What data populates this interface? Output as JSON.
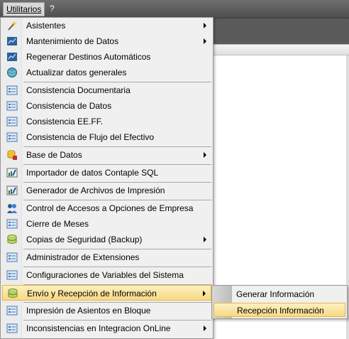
{
  "menubar": {
    "items": [
      {
        "label": "Utilitarios"
      },
      {
        "label": "?"
      }
    ]
  },
  "menu": {
    "items": [
      {
        "label": "Asistentes",
        "icon": "wand-icon",
        "submenu": true
      },
      {
        "label": "Mantenimiento de Datos",
        "icon": "dataset-icon",
        "submenu": true
      },
      {
        "label": "Regenerar Destinos Automáticos",
        "icon": "dataset-icon",
        "submenu": false
      },
      {
        "label": "Actualizar datos generales",
        "icon": "globe-icon",
        "submenu": false
      },
      {
        "label": "Consistencia Documentaria",
        "icon": "form-icon",
        "submenu": false
      },
      {
        "label": "Consistencia de Datos",
        "icon": "form-icon",
        "submenu": false
      },
      {
        "label": "Consistencia EE.FF.",
        "icon": "form-icon",
        "submenu": false
      },
      {
        "label": "Consistencia de Flujo del Efectivo",
        "icon": "form-icon",
        "submenu": false
      },
      {
        "label": "Base de Datos",
        "icon": "database-lock-icon",
        "submenu": true
      },
      {
        "label": "Importador de datos Contaple SQL",
        "icon": "chart-import-icon",
        "submenu": false
      },
      {
        "label": "Generador de Archivos de Impresión",
        "icon": "chart-import-icon",
        "submenu": false
      },
      {
        "label": "Control de Accesos a Opciones de Empresa",
        "icon": "users-icon",
        "submenu": false
      },
      {
        "label": "Cierre de Meses",
        "icon": "form-icon",
        "submenu": false
      },
      {
        "label": "Copias de Seguridad (Backup)",
        "icon": "database-icon",
        "submenu": true
      },
      {
        "label": "Administrador de Extensiones",
        "icon": "form-icon",
        "submenu": false
      },
      {
        "label": "Configuraciones de Variables del Sistema",
        "icon": "form-icon",
        "submenu": false
      },
      {
        "label": "Envío y Recepción de Información",
        "icon": "database-icon",
        "submenu": true
      },
      {
        "label": "Impresión de Asientos en Bloque",
        "icon": "form-icon",
        "submenu": false
      },
      {
        "label": "Inconsistencias en Integracion OnLine",
        "icon": "form-icon",
        "submenu": true
      }
    ]
  },
  "submenu": {
    "items": [
      {
        "label": "Generar Información"
      },
      {
        "label": "Recepción Información"
      }
    ]
  },
  "colors": {
    "highlight_top": "#fdf0bf",
    "highlight_bottom": "#f7d886",
    "highlight_border": "#e5b84a",
    "menu_bg": "#f0f0f0"
  }
}
